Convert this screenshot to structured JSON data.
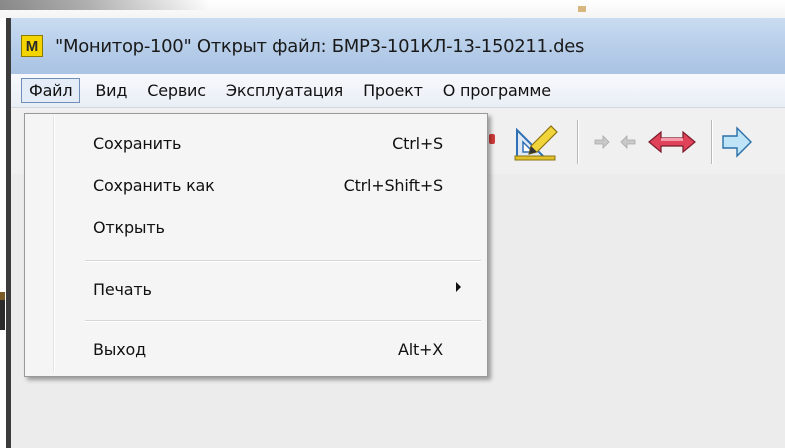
{
  "window": {
    "app_icon_letter": "M",
    "title": "\"Монитор-100\"   Открыт файл: БМР3-101КЛ-13-150211.des"
  },
  "menubar": {
    "items": [
      {
        "label": "Файл"
      },
      {
        "label": "Вид"
      },
      {
        "label": "Сервис"
      },
      {
        "label": "Эксплуатация"
      },
      {
        "label": "Проект"
      },
      {
        "label": "О программе"
      }
    ]
  },
  "toolbar": {
    "icons": [
      "ruler-pencil-icon",
      "double-arrows-icon",
      "red-bidirectional-arrow-icon",
      "blue-arrow-icon"
    ]
  },
  "file_menu": {
    "items": [
      {
        "label": "Сохранить",
        "shortcut": "Ctrl+S"
      },
      {
        "label": "Сохранить как",
        "shortcut": "Ctrl+Shift+S"
      },
      {
        "label": "Открыть",
        "shortcut": ""
      },
      {
        "label": "Печать",
        "shortcut": ""
      },
      {
        "label": "Выход",
        "shortcut": "Alt+X"
      }
    ]
  },
  "colors": {
    "titlebar": "#b6cde9",
    "app_icon": "#f3d400",
    "menu_active_border": "#6f8fb8"
  }
}
